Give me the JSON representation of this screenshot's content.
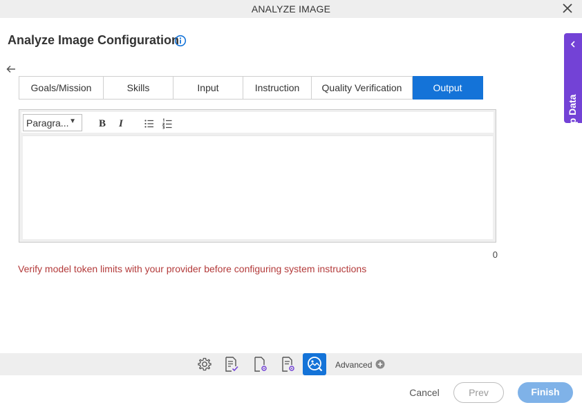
{
  "window": {
    "title": "ANALYZE IMAGE"
  },
  "page": {
    "title": "Analyze Image Configuration"
  },
  "tabs": [
    {
      "label": "Goals/Mission"
    },
    {
      "label": "Skills"
    },
    {
      "label": "Input"
    },
    {
      "label": "Instruction"
    },
    {
      "label": "Quality Verification"
    },
    {
      "label": "Output",
      "active": true
    }
  ],
  "editor": {
    "format_select": "Paragra...",
    "bold_label": "B",
    "italic_label": "I",
    "content": "",
    "char_count": "0"
  },
  "warning": "Verify model token limits with your provider before configuring system instructions",
  "side_panel": {
    "label": "App Data"
  },
  "bottom_toolbar": {
    "advanced_label": "Advanced"
  },
  "footer": {
    "cancel": "Cancel",
    "prev": "Prev",
    "finish": "Finish"
  },
  "colors": {
    "accent": "#1473d8",
    "side_panel": "#7342d6",
    "warning": "#b33a3a",
    "finish_disabled": "#7fb2e8"
  }
}
